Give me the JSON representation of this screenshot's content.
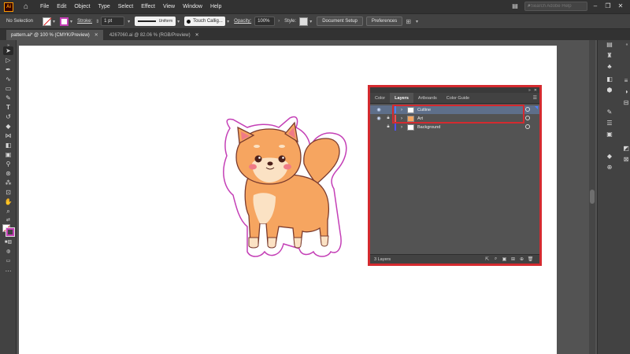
{
  "app": {
    "logo_text": "Ai"
  },
  "menu": [
    "File",
    "Edit",
    "Object",
    "Type",
    "Select",
    "Effect",
    "View",
    "Window",
    "Help"
  ],
  "search": {
    "placeholder": "Search Adobe Help"
  },
  "control_bar": {
    "selection": "No Selection",
    "stroke_label": "Stroke:",
    "stroke_value": "1 pt",
    "profile": "Uniform",
    "brush": "Touch Callig...",
    "opacity_label": "Opacity:",
    "opacity_value": "100%",
    "style_label": "Style:",
    "document_setup": "Document Setup",
    "preferences": "Preferences"
  },
  "tabs": [
    {
      "label": "pattern.ai* @ 100 % (CMYK/Preview)",
      "active": true
    },
    {
      "label": "4267060.ai @ 82.06 % (RGB/Preview)",
      "active": false
    }
  ],
  "panel": {
    "tabs": [
      "Color",
      "Layers",
      "Artboards",
      "Color Guide"
    ],
    "active_tab": "Layers",
    "layers": [
      {
        "name": "Cutline",
        "visible": true,
        "locked": false,
        "color": "#4f7fff",
        "selected": true
      },
      {
        "name": "Art",
        "visible": true,
        "locked": true,
        "color": "#ff4f4f",
        "selected": false
      },
      {
        "name": "Background",
        "visible": false,
        "locked": true,
        "color": "#4f4fff",
        "selected": false
      }
    ],
    "layer_count": "3 Layers"
  },
  "colors": {
    "highlight_red": "#d42a2f",
    "dog_body": "#f6a560",
    "dog_outline": "#7a3b2e",
    "cutline": "#c43fb6"
  },
  "icons": {
    "toolbar": [
      "selection-tool-icon",
      "direct-selection-tool-icon",
      "pen-tool-icon",
      "curvature-tool-icon",
      "rectangle-tool-icon",
      "paintbrush-tool-icon",
      "type-tool-icon",
      "rotate-tool-icon",
      "eraser-tool-icon",
      "width-tool-icon",
      "shape-builder-tool-icon",
      "eyedropper-tool-icon",
      "blend-tool-icon",
      "artboard-tool-icon",
      "hand-tool-icon",
      "zoom-tool-icon"
    ]
  }
}
